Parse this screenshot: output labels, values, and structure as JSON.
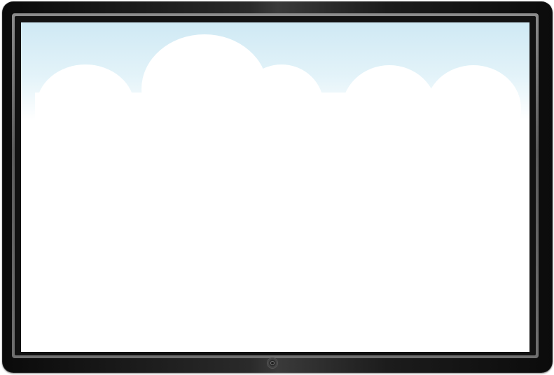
{
  "device": {
    "type": "tablet",
    "frame_color": "#1a1a1a",
    "bezel_color": "#707070"
  },
  "screen": {
    "background": "#ffffff",
    "sky_color": "#cfe9f4",
    "cloud_color": "#ffffff"
  },
  "controls": {
    "home_button_icon": "home-button-icon"
  }
}
